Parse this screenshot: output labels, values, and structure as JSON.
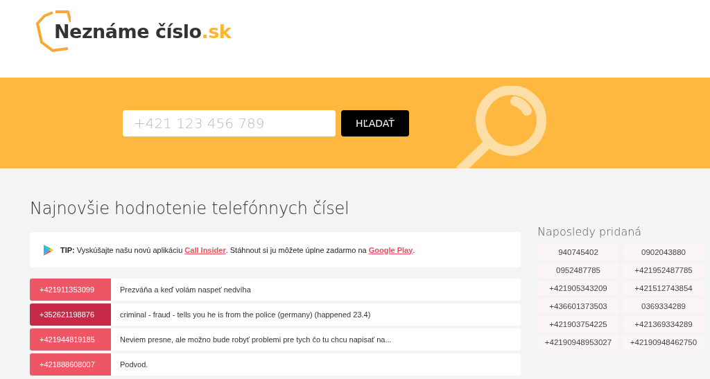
{
  "logo": {
    "name": "Neznáme číslo",
    "tld": ".sk"
  },
  "search": {
    "placeholder": "+421 123 456 789",
    "button": "HĽADAŤ"
  },
  "heading": "Najnovšie hodnotenie telefónnych čísel",
  "tip": [
    {
      "kind": "text",
      "text": "**TIP:** Vyskúšajte našu novú aplikáciu "
    },
    {
      "kind": "link",
      "text": "Call Insider"
    },
    {
      "kind": "text",
      "text": ". Stáhnout si ju môžete úplne zadarmo na "
    },
    {
      "kind": "link",
      "text": "Google Play"
    },
    {
      "kind": "text",
      "text": "."
    }
  ],
  "reviews": [
    {
      "number": "+421911353099",
      "comment": "Prezváňa a keď volám naspeť nedvíha",
      "color": "#ee5565"
    },
    {
      "number": "+352621198876",
      "comment": "criminal - fraud - tells you he is from the police (germany) (happened 23.4)",
      "color": "#c62a47"
    },
    {
      "number": "+421944819185",
      "comment": "Neviem presne, ale možno bude robyť problemi pre tych čo tu chcu napisať na...",
      "color": "#ee5565"
    },
    {
      "number": "+421888608007",
      "comment": "Podvod.",
      "color": "#ee5565"
    }
  ],
  "recent": {
    "title": "Naposledy pridaná",
    "numbers": [
      "940745402",
      "0902043880",
      "0952487785",
      "+421952487785",
      "+421905343209",
      "+421512743854",
      "+436601373503",
      "0369334289",
      "+421903754225",
      "+421369334289",
      "+42190948953027",
      "+42190948462750"
    ]
  }
}
